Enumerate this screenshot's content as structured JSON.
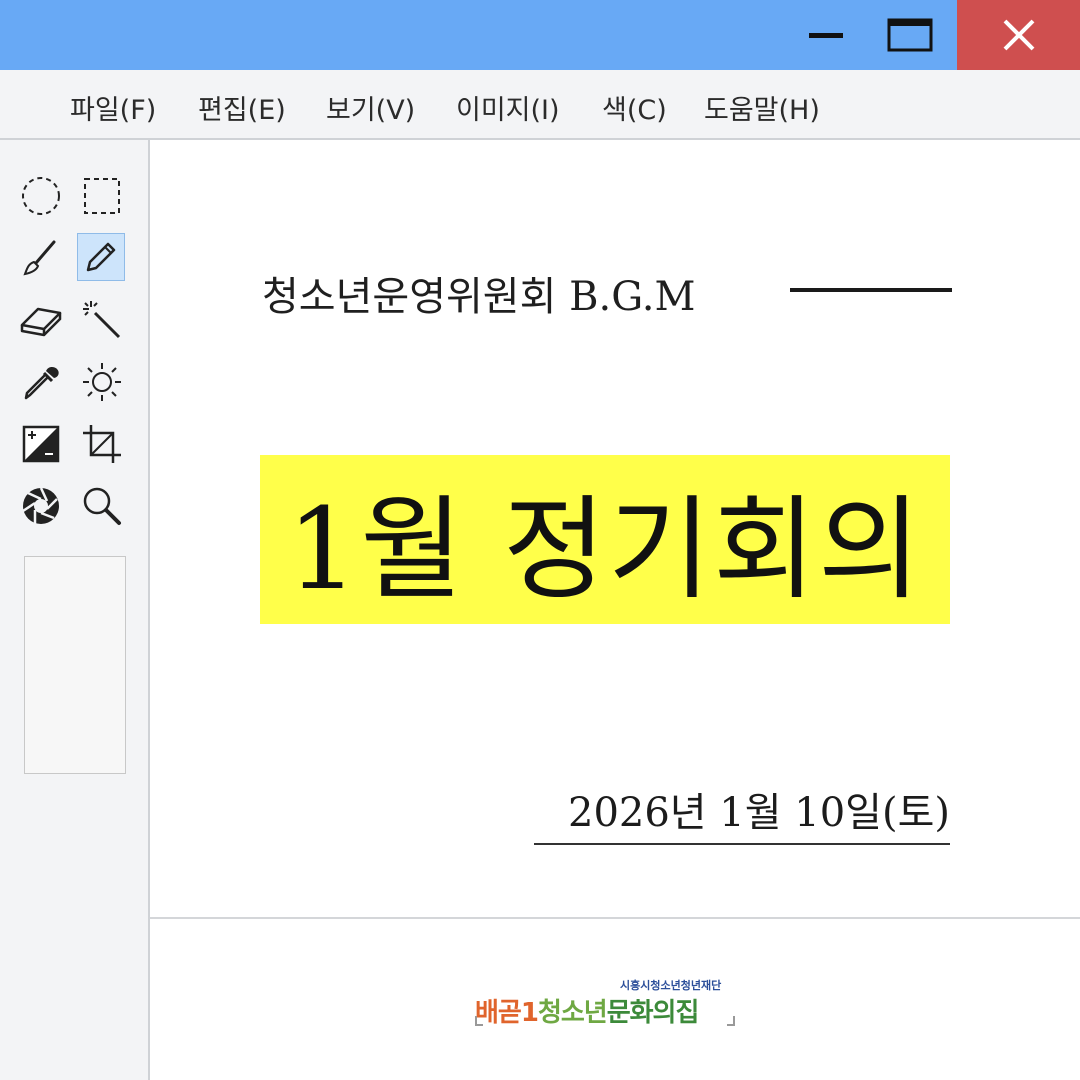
{
  "window": {
    "controls": {
      "minimize_icon": "minimize-icon",
      "maximize_icon": "maximize-icon",
      "close_icon": "close-icon",
      "titlebar_color": "#68a9f5",
      "close_color": "#cf4f4f"
    }
  },
  "menu": {
    "items": [
      "파일(F)",
      "편집(E)",
      "보기(V)",
      "이미지(I)",
      "색(C)",
      "도움말(H)"
    ]
  },
  "tools": [
    {
      "name": "ellipse-select",
      "icon": "dashed-circle-icon"
    },
    {
      "name": "rectangle-select",
      "icon": "dashed-square-icon"
    },
    {
      "name": "brush",
      "icon": "brush-icon"
    },
    {
      "name": "pencil",
      "icon": "pencil-icon",
      "active": true
    },
    {
      "name": "eraser",
      "icon": "eraser-icon"
    },
    {
      "name": "magic-wand",
      "icon": "magic-wand-icon"
    },
    {
      "name": "color-picker",
      "icon": "eyedropper-icon"
    },
    {
      "name": "brightness",
      "icon": "sun-icon"
    },
    {
      "name": "contrast",
      "icon": "contrast-icon"
    },
    {
      "name": "crop",
      "icon": "crop-icon"
    },
    {
      "name": "aperture",
      "icon": "aperture-icon"
    },
    {
      "name": "zoom",
      "icon": "magnifier-icon"
    }
  ],
  "document": {
    "subtitle": "청소년운영위원회 B.G.M",
    "headline": "1월 정기회의",
    "highlight_color": "#ffff4a",
    "date": "2026년  1월 10일(토)"
  },
  "logo": {
    "org": "시흥시청소년청년재단",
    "part1": "배곧1",
    "part2": "청소년",
    "part3": "문화의집",
    "colors": {
      "part1": "#e0642c",
      "part2": "#6fa843",
      "part3": "#3c8a3a"
    }
  }
}
